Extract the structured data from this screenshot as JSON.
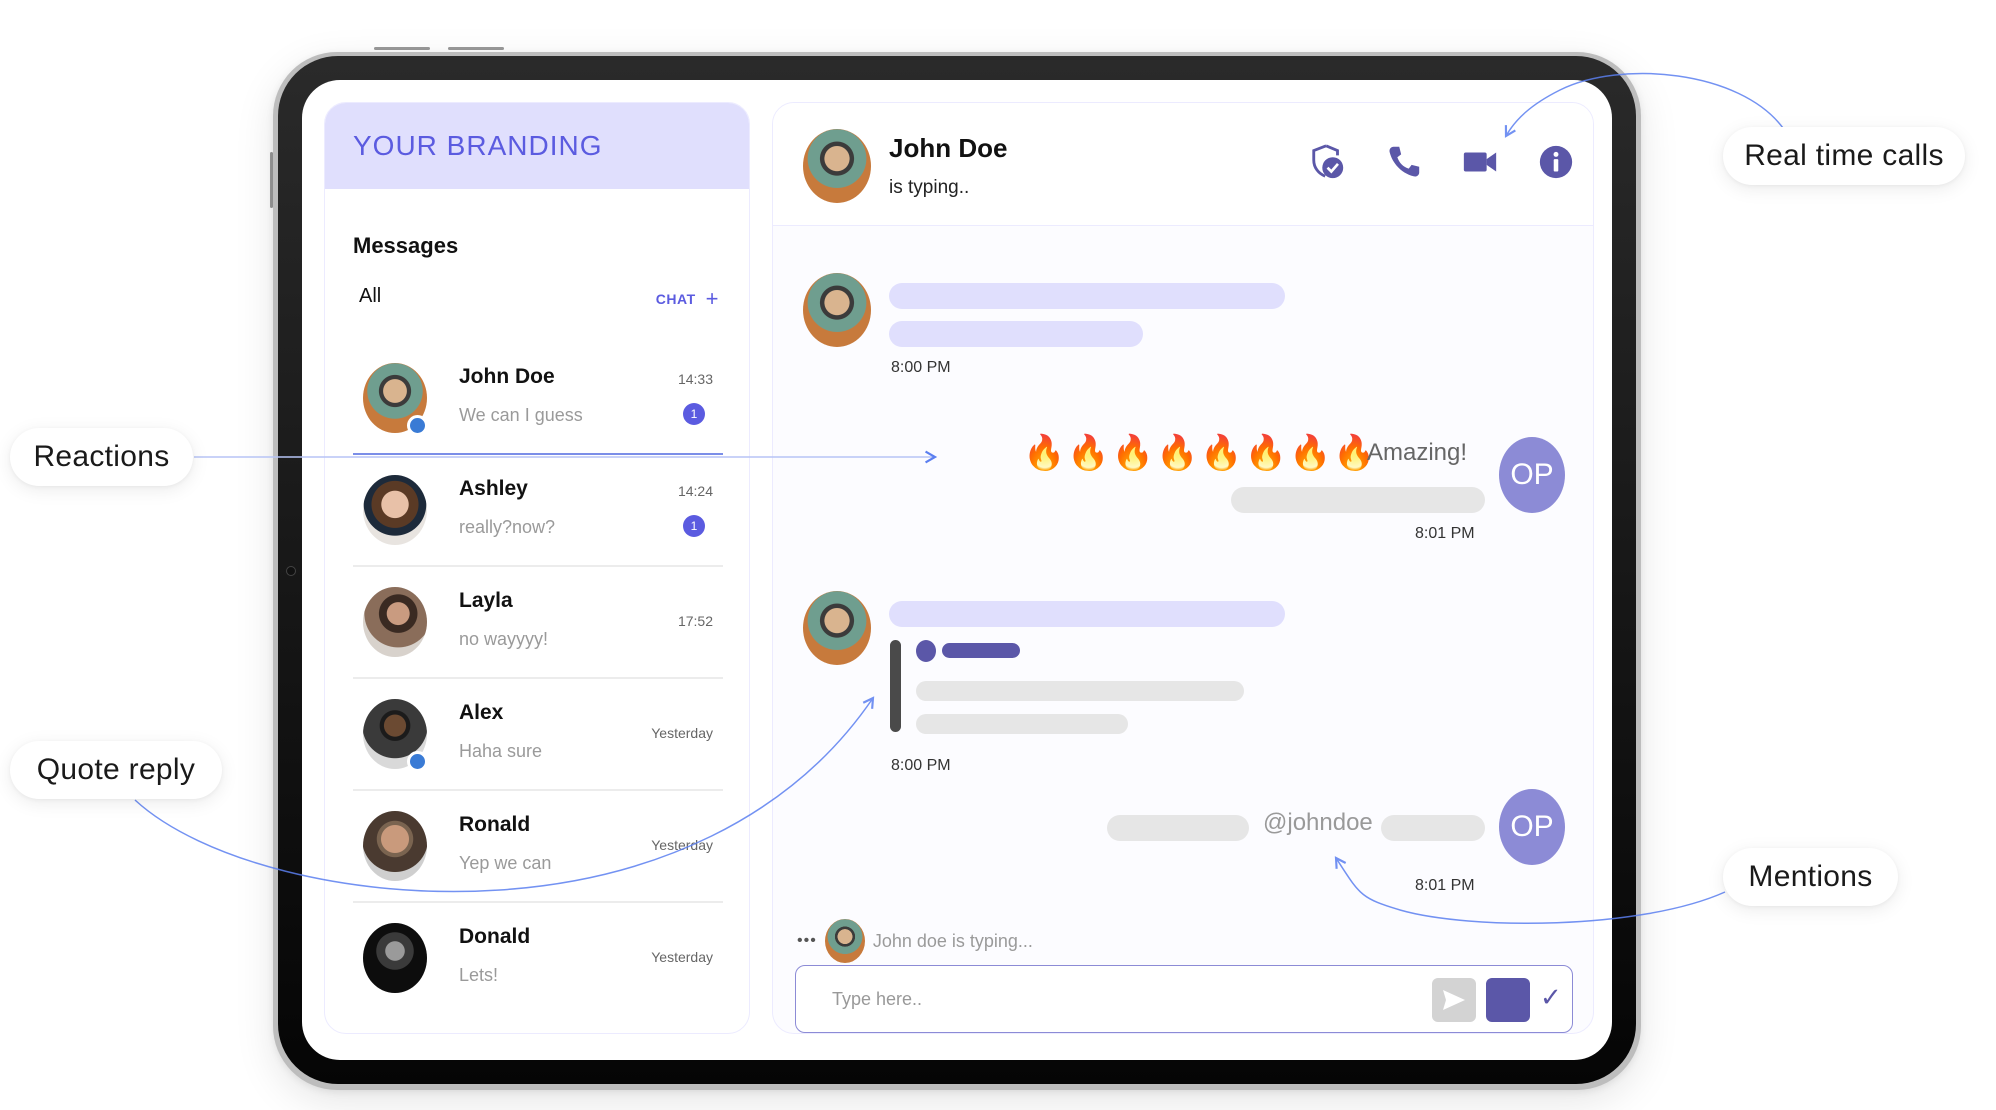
{
  "colors": {
    "brand_bg": "#e0dffd",
    "brand_text": "#5b5be0",
    "icon_purple": "#5b57a8",
    "op_avatar": "#8c8bd6",
    "online": "#3a7bd5",
    "annotation_line": "#5b7ff0"
  },
  "sidebar": {
    "brand": "YOUR BRANDING",
    "title": "Messages",
    "filter": "All",
    "new_chat_label": "CHAT",
    "new_chat_icon": "plus-icon",
    "conversations": [
      {
        "name": "John Doe",
        "preview": "We can I guess",
        "time": "14:33",
        "unread": "1",
        "online": true,
        "active": true
      },
      {
        "name": "Ashley",
        "preview": "really?now?",
        "time": "14:24",
        "unread": "1",
        "online": false
      },
      {
        "name": "Layla",
        "preview": "no wayyyy!",
        "time": "17:52",
        "online": false
      },
      {
        "name": "Alex",
        "preview": "Haha sure",
        "time": "Yesterday",
        "online": true
      },
      {
        "name": "Ronald",
        "preview": "Yep we can",
        "time": "Yesterday",
        "online": false
      },
      {
        "name": "Donald",
        "preview": "Lets!",
        "time": "Yesterday",
        "online": false
      }
    ]
  },
  "chat": {
    "contact_name": "John Doe",
    "contact_status": "is typing..",
    "header_icons": [
      "shield-check-icon",
      "phone-icon",
      "video-camera-icon",
      "info-icon"
    ],
    "messages": [
      {
        "from": "John Doe",
        "time": "8:00 PM"
      },
      {
        "from": "OP",
        "reactions": "🔥🔥🔥🔥🔥🔥🔥🔥",
        "reaction_count": 8,
        "text": "Amazing!",
        "time": "8:01 PM",
        "avatar": "OP"
      },
      {
        "from": "John Doe",
        "type": "quote",
        "time": "8:00 PM"
      },
      {
        "from": "OP",
        "mention": "@johndoe",
        "time": "8:01 PM",
        "avatar": "OP"
      }
    ],
    "typing_indicator": "John doe is typing...",
    "typing_dots": "•••",
    "composer": {
      "placeholder": "Type here..",
      "value": "",
      "check_glyph": "✓"
    }
  },
  "callouts": {
    "reactions": "Reactions",
    "quote_reply": "Quote reply",
    "real_time_calls": "Real time calls",
    "mentions": "Mentions"
  }
}
